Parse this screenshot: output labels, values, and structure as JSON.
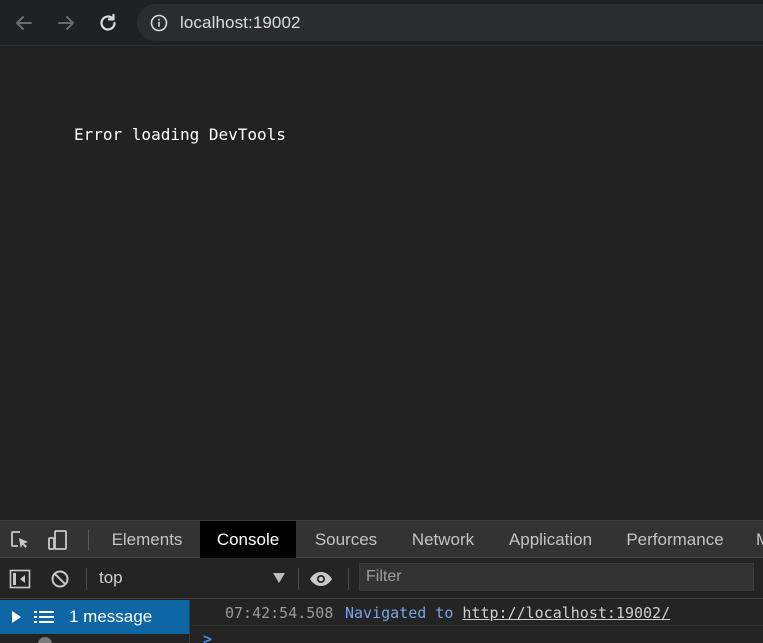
{
  "browser": {
    "url": "localhost:19002"
  },
  "page": {
    "error_text": "Error loading DevTools"
  },
  "devtools": {
    "tabs": [
      {
        "label": "Elements"
      },
      {
        "label": "Console"
      },
      {
        "label": "Sources"
      },
      {
        "label": "Network"
      },
      {
        "label": "Application"
      },
      {
        "label": "Performance"
      },
      {
        "label": "M"
      }
    ],
    "active_tab": "Console",
    "context": "top",
    "filter_placeholder": "Filter",
    "sidebar": {
      "items": [
        {
          "label": "1 message"
        }
      ]
    },
    "log": [
      {
        "timestamp": "07:42:54.508",
        "message_prefix": "Navigated to",
        "link": "http://localhost:19002/"
      }
    ],
    "prompt_symbol": ">"
  },
  "colors": {
    "accent": "#0f66a4",
    "background": "#222222",
    "log_link": "#7aa3e5"
  },
  "icons": [
    "back-arrow-icon",
    "forward-arrow-icon",
    "reload-icon",
    "info-icon",
    "inspect-element-icon",
    "device-toolbar-icon",
    "sidebar-toggle-icon",
    "clear-console-icon",
    "eye-icon",
    "list-icon"
  ]
}
